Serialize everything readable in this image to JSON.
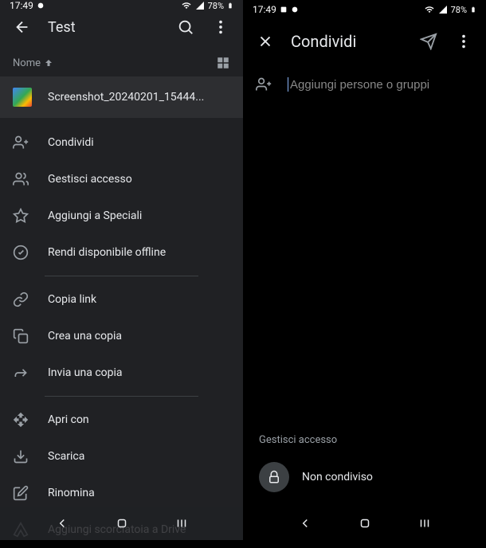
{
  "left": {
    "status": {
      "time": "17:49",
      "battery": "78%"
    },
    "appbar": {
      "title": "Test"
    },
    "sort": {
      "label": "Nome"
    },
    "file": {
      "name": "Screenshot_20240201_15444..."
    },
    "menu": {
      "share": "Condividi",
      "manage_access": "Gestisci accesso",
      "add_star": "Aggiungi a Speciali",
      "offline": "Rendi disponibile offline",
      "copy_link": "Copia link",
      "make_copy": "Crea una copia",
      "send_copy": "Invia una copia",
      "open_with": "Apri con",
      "download": "Scarica",
      "rename": "Rinomina",
      "add_shortcut": "Aggiungi scorciatoia a Drive"
    }
  },
  "right": {
    "status": {
      "time": "17:49",
      "battery": "78%"
    },
    "appbar": {
      "title": "Condividi"
    },
    "input": {
      "placeholder": "Aggiungi persone o gruppi"
    },
    "manage_access": "Gestisci accesso",
    "not_shared": "Non condiviso"
  }
}
